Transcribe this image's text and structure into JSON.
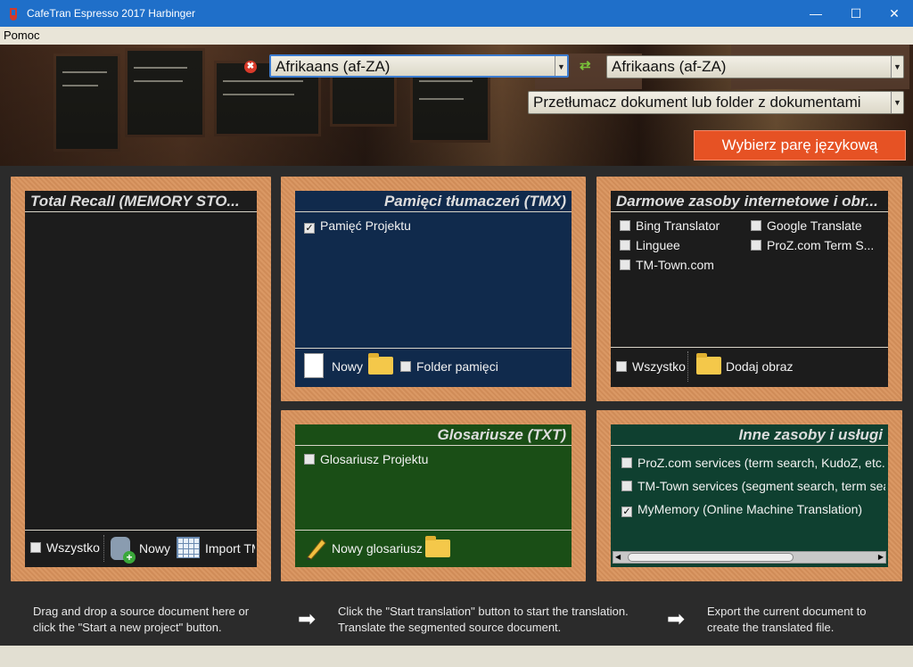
{
  "window": {
    "title": "CafeTran Espresso 2017 Harbinger",
    "controls": {
      "minimize": "—",
      "maximize": "☐",
      "close": "✕"
    }
  },
  "menu": {
    "items": [
      "Pomoc"
    ]
  },
  "language_bar": {
    "source_language": "Afrikaans (af-ZA)",
    "target_language": "Afrikaans (af-ZA)",
    "mode": "Przetłumacz dokument lub folder z dokumentami",
    "select_pair_button": "Wybierz parę językową"
  },
  "panels": {
    "total_recall": {
      "title": "Total Recall (MEMORY STO...",
      "footer": {
        "all": "Wszystko",
        "new": "Nowy",
        "import": "Import TM"
      }
    },
    "tmx": {
      "title": "Pamięci tłumaczeń (TMX)",
      "items": [
        {
          "label": "Pamięć Projektu",
          "checked": true
        }
      ],
      "footer": {
        "new": "Nowy",
        "folder": "Folder pamięci"
      }
    },
    "free_resources": {
      "title": "Darmowe zasoby internetowe i obr...",
      "items": [
        {
          "label": "Bing Translator",
          "checked": false
        },
        {
          "label": "Google Translate",
          "checked": false
        },
        {
          "label": "Linguee",
          "checked": false
        },
        {
          "label": "ProZ.com Term S...",
          "checked": false
        },
        {
          "label": "TM-Town.com",
          "checked": false
        }
      ],
      "footer": {
        "all": "Wszystko",
        "add_image": "Dodaj obraz"
      }
    },
    "glossaries": {
      "title": "Glosariusze (TXT)",
      "items": [
        {
          "label": "Glosariusz Projektu",
          "checked": false
        }
      ],
      "footer": {
        "new": "Nowy glosariusz"
      }
    },
    "other_services": {
      "title": "Inne zasoby i usługi",
      "items": [
        {
          "label": "ProZ.com services (term search, KudoZ, etc. - ",
          "checked": false
        },
        {
          "label": "TM-Town services (segment search, term sea",
          "checked": false
        },
        {
          "label": "MyMemory (Online Machine Translation)",
          "checked": true
        }
      ],
      "scroll_left": "◀",
      "scroll_right": "▶"
    }
  },
  "hints": {
    "step1": [
      "Drag and drop a source document here or",
      "click the \"Start a new project\" button."
    ],
    "step2": [
      "Click the \"Start translation\" button to start the translation.",
      "Translate the segmented source document."
    ],
    "step3": [
      "Export the current document to",
      "create the translated file."
    ]
  },
  "icons": {
    "remove": "✖",
    "swap": "⇄",
    "arrow": "➡",
    "check": "✓",
    "dropdown": "▼"
  },
  "colors": {
    "titlebar": "#1f6fc9",
    "pair_button": "#e65224",
    "panel_frame": "#d8925c",
    "tmx_bg": "#102a4c",
    "glossary_bg": "#1a4e16",
    "services_bg": "#0f4030"
  }
}
